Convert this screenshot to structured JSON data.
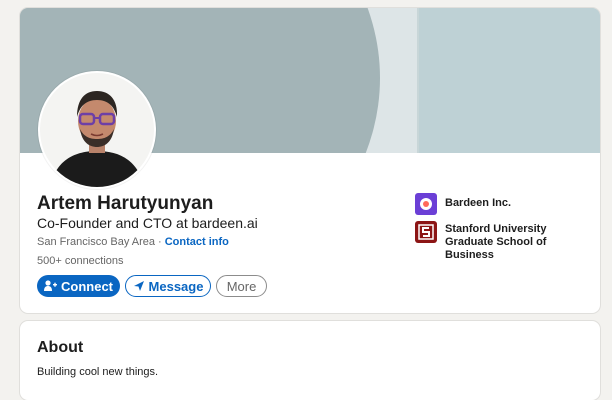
{
  "profile": {
    "name": "Artem Harutyunyan",
    "headline": "Co-Founder and CTO at bardeen.ai",
    "location": "San Francisco Bay Area",
    "separator": "·",
    "contact_info_label": "Contact info",
    "connections": "500+ connections"
  },
  "actions": {
    "connect_label": "Connect",
    "message_label": "Message",
    "more_label": "More"
  },
  "organizations": [
    {
      "name": "Bardeen Inc.",
      "icon": "bardeen-logo",
      "color": "#6b3fd6"
    },
    {
      "name": "Stanford University Graduate School of Business",
      "icon": "stanford-logo",
      "color": "#8c1515"
    }
  ],
  "about": {
    "title": "About",
    "text": "Building cool new things."
  },
  "colors": {
    "accent": "#0a66c2",
    "banner": "#a3b4b7"
  }
}
